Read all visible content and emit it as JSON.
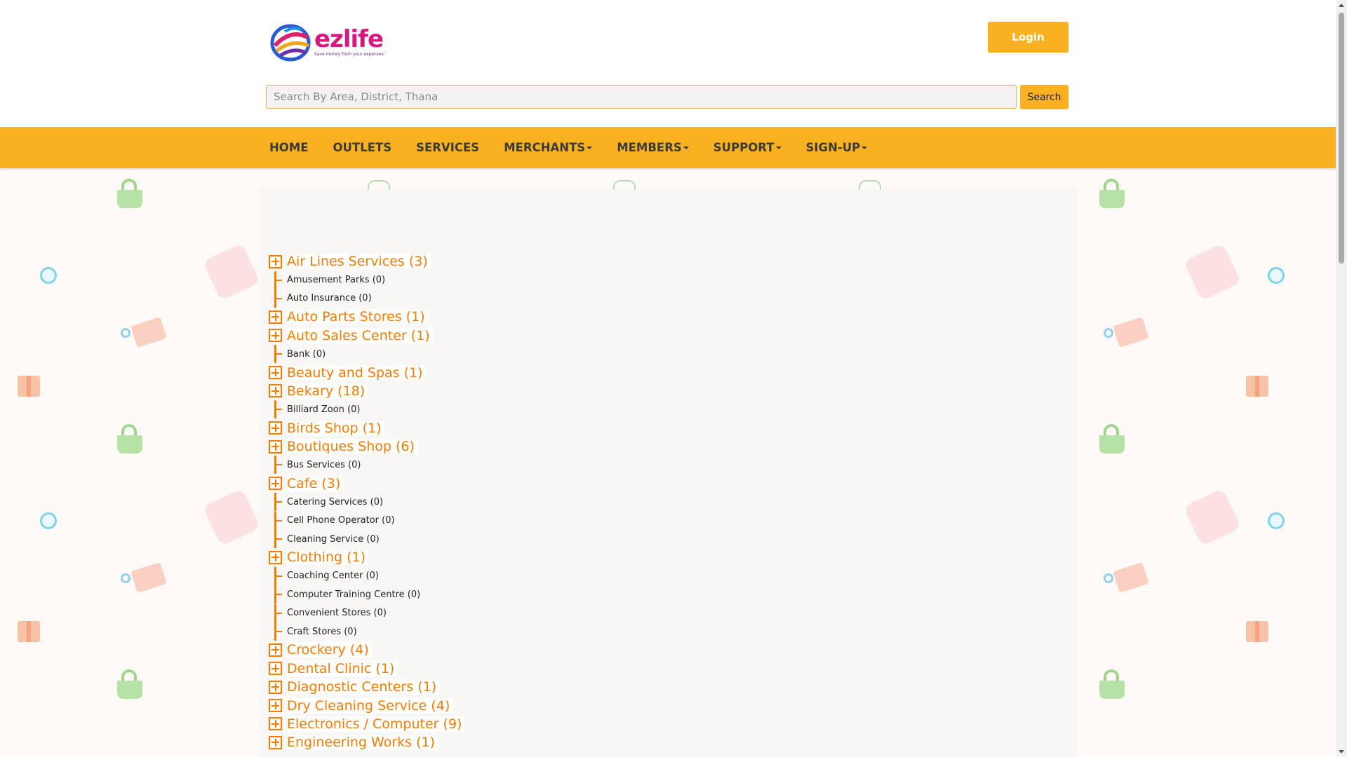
{
  "colors": {
    "accent": "#f9b021",
    "tree_orange": "#f57c00",
    "logo_pink": "#d6187f"
  },
  "logo": {
    "word": "ezlife",
    "tagline": "Save money from your expenses"
  },
  "header": {
    "login_label": "Login"
  },
  "search": {
    "placeholder": "Search By Area, District, Thana",
    "button_label": "Search"
  },
  "nav": {
    "home": "HOME",
    "outlets": "OUTLETS",
    "services": "SERVICES",
    "merchants": "MERCHANTS",
    "members": "MEMBERS",
    "support": "SUPPORT",
    "signup": "SIGN-UP"
  },
  "categories": [
    {
      "label": "Air Lines Services (3)",
      "expandable": true
    },
    {
      "label": "Amusement Parks (0)",
      "expandable": false
    },
    {
      "label": "Auto Insurance (0)",
      "expandable": false
    },
    {
      "label": "Auto Parts Stores (1)",
      "expandable": true
    },
    {
      "label": "Auto Sales Center (1)",
      "expandable": true
    },
    {
      "label": "Bank (0)",
      "expandable": false
    },
    {
      "label": "Beauty and Spas (1)",
      "expandable": true
    },
    {
      "label": "Bekary (18)",
      "expandable": true
    },
    {
      "label": "Billiard Zoon (0)",
      "expandable": false
    },
    {
      "label": "Birds Shop (1)",
      "expandable": true
    },
    {
      "label": "Boutiques Shop (6)",
      "expandable": true
    },
    {
      "label": "Bus Services (0)",
      "expandable": false
    },
    {
      "label": "Cafe (3)",
      "expandable": true
    },
    {
      "label": "Catering Services (0)",
      "expandable": false
    },
    {
      "label": "Cell Phone Operator (0)",
      "expandable": false
    },
    {
      "label": "Cleaning Service (0)",
      "expandable": false
    },
    {
      "label": "Clothing (1)",
      "expandable": true
    },
    {
      "label": "Coaching Center (0)",
      "expandable": false
    },
    {
      "label": "Computer Training Centre (0)",
      "expandable": false
    },
    {
      "label": "Convenient Stores (0)",
      "expandable": false
    },
    {
      "label": "Craft Stores (0)",
      "expandable": false
    },
    {
      "label": "Crockery (4)",
      "expandable": true
    },
    {
      "label": "Dental Clinic (1)",
      "expandable": true
    },
    {
      "label": "Diagnostic Centers (1)",
      "expandable": true
    },
    {
      "label": "Dry Cleaning Service (4)",
      "expandable": true
    },
    {
      "label": "Electronics / Computer (9)",
      "expandable": true
    },
    {
      "label": "Engineering Works (1)",
      "expandable": true
    }
  ]
}
